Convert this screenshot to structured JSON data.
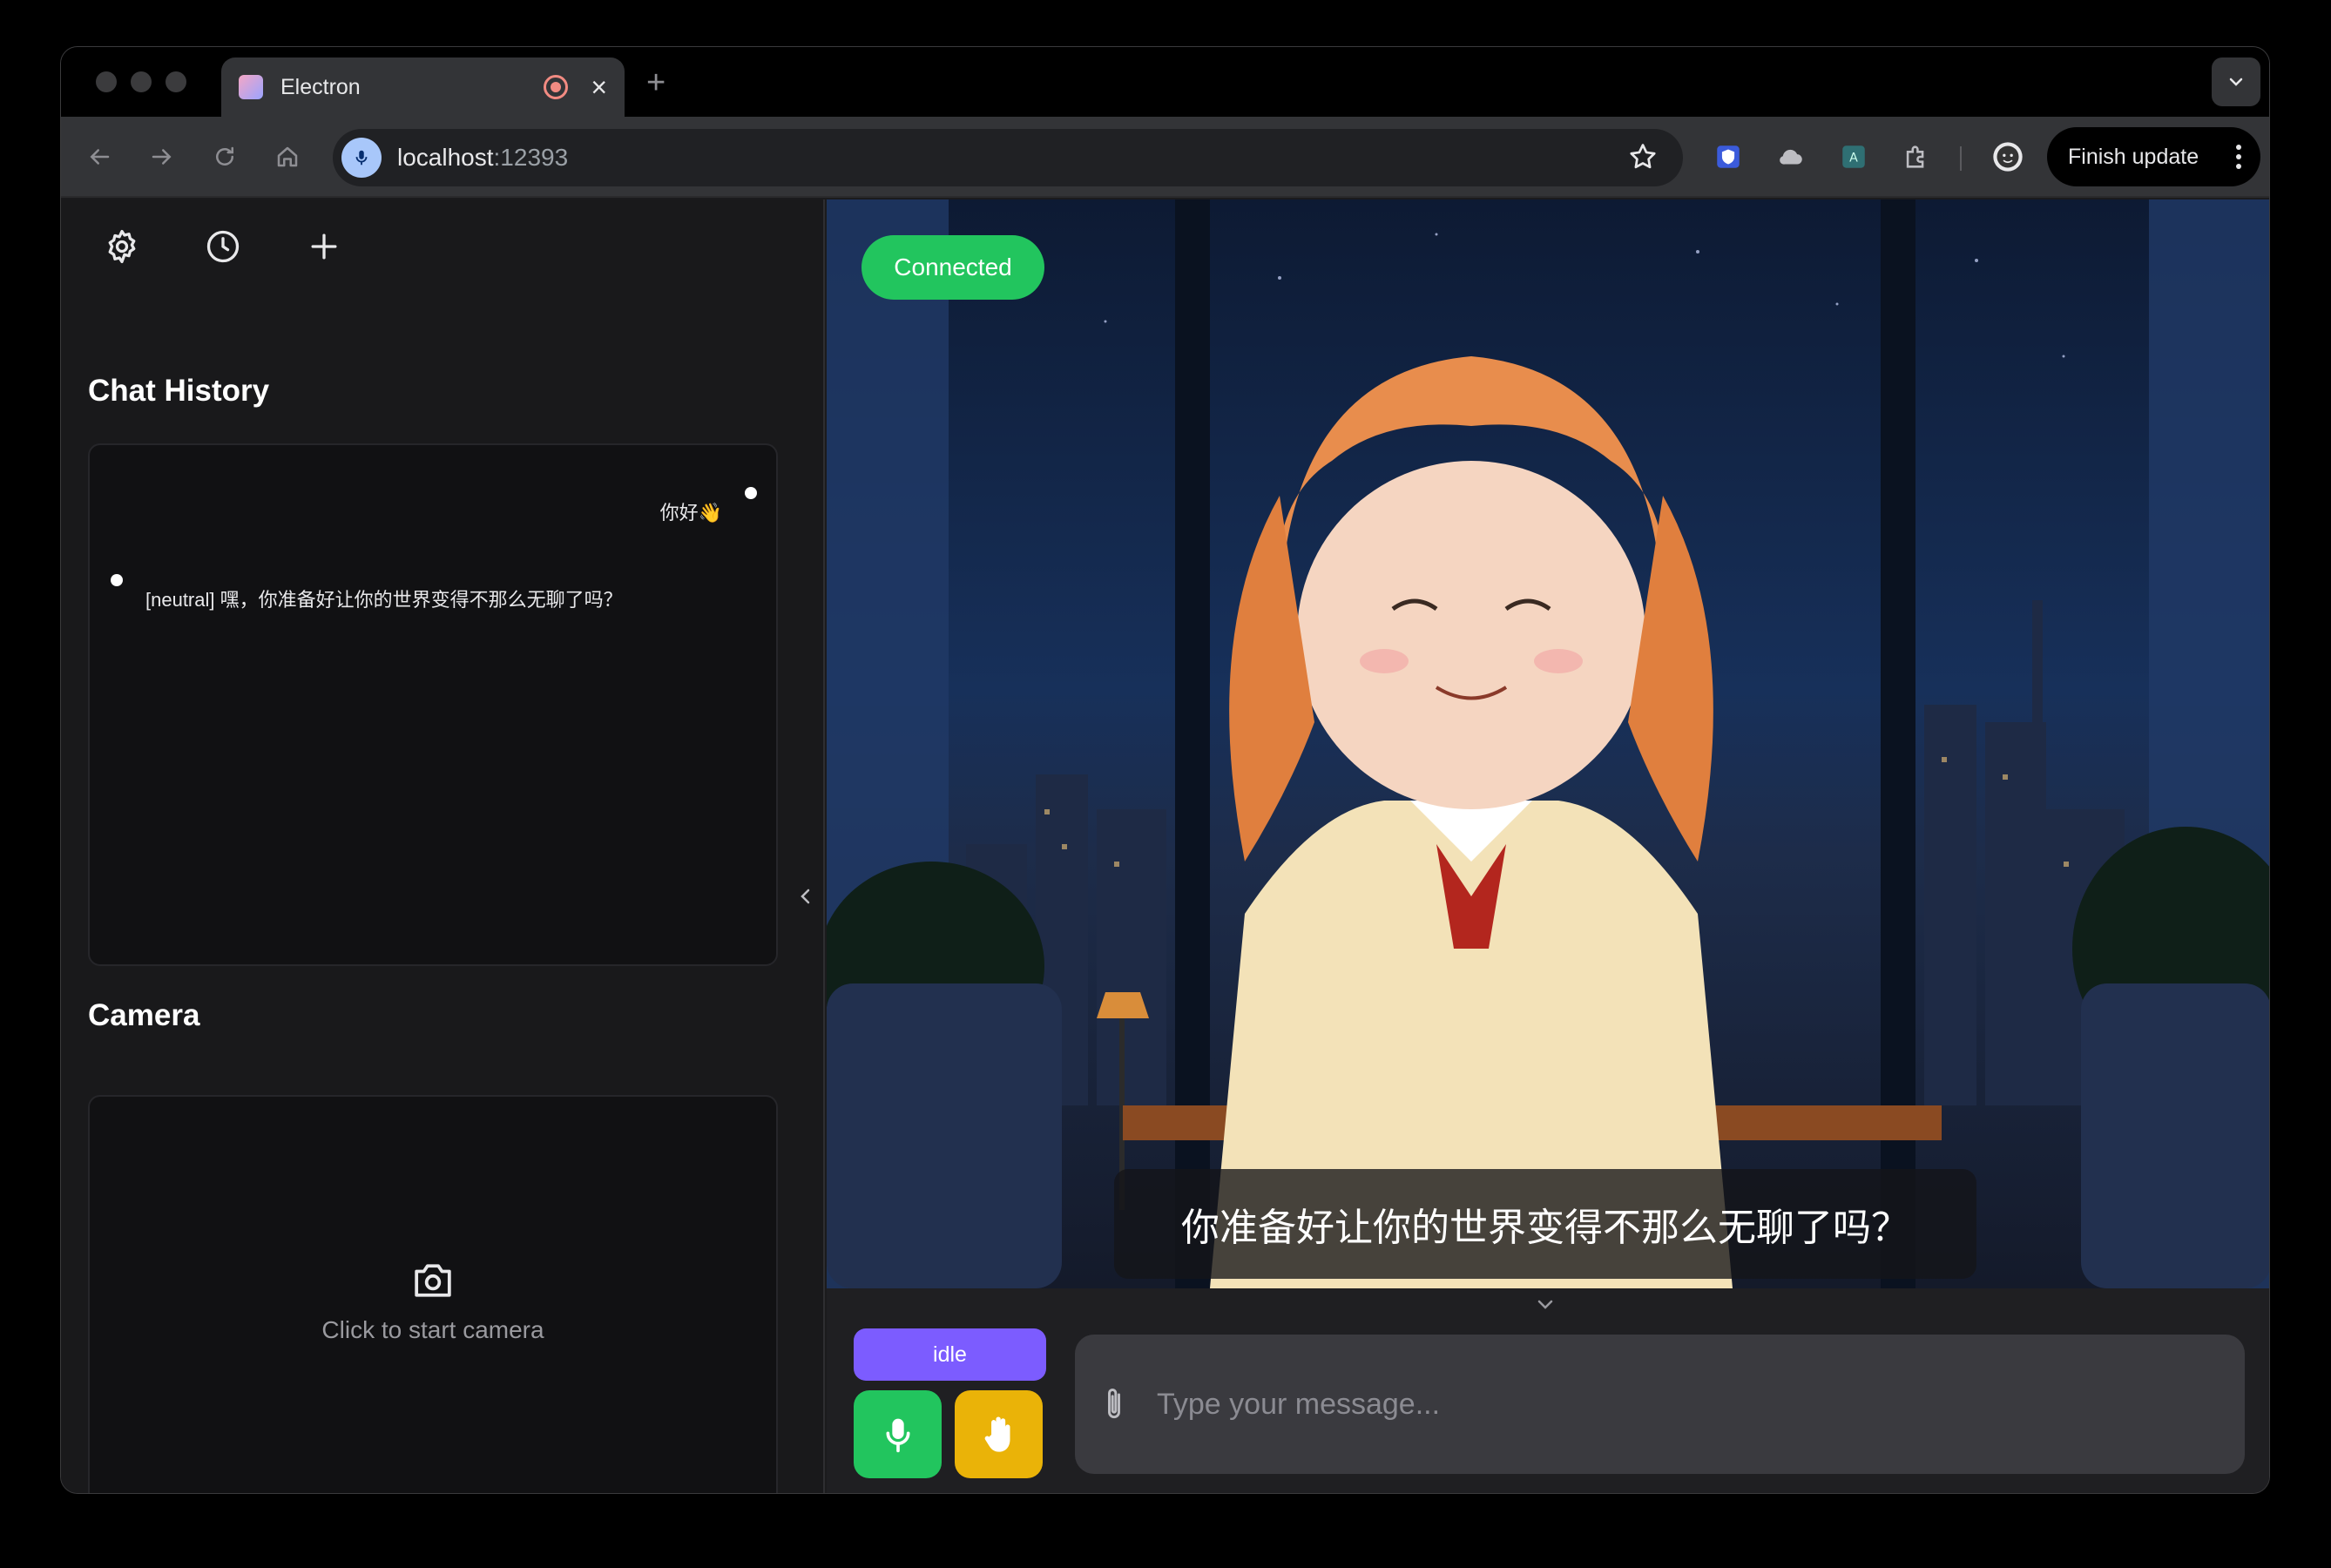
{
  "browser": {
    "tab_title": "Electron",
    "url_host": "localhost",
    "url_port": ":12393",
    "finish_update_label": "Finish update"
  },
  "sidebar": {
    "icons": [
      "gear-icon",
      "clock-icon",
      "plus-icon"
    ],
    "chat_history_title": "Chat History",
    "messages": {
      "user": "你好👋",
      "ai": "[neutral] 嘿，你准备好让你的世界变得不那么无聊了吗？"
    },
    "camera_title": "Camera",
    "camera_hint": "Click to start camera"
  },
  "stage": {
    "status": "Connected",
    "subtitle": "你准备好让你的世界变得不那么无聊了吗？"
  },
  "controls": {
    "state": "idle",
    "input_placeholder": "Type your message..."
  },
  "colors": {
    "connected": "#22c55e",
    "idle": "#7c5cff",
    "mic": "#22c55e",
    "interrupt": "#eab308"
  }
}
